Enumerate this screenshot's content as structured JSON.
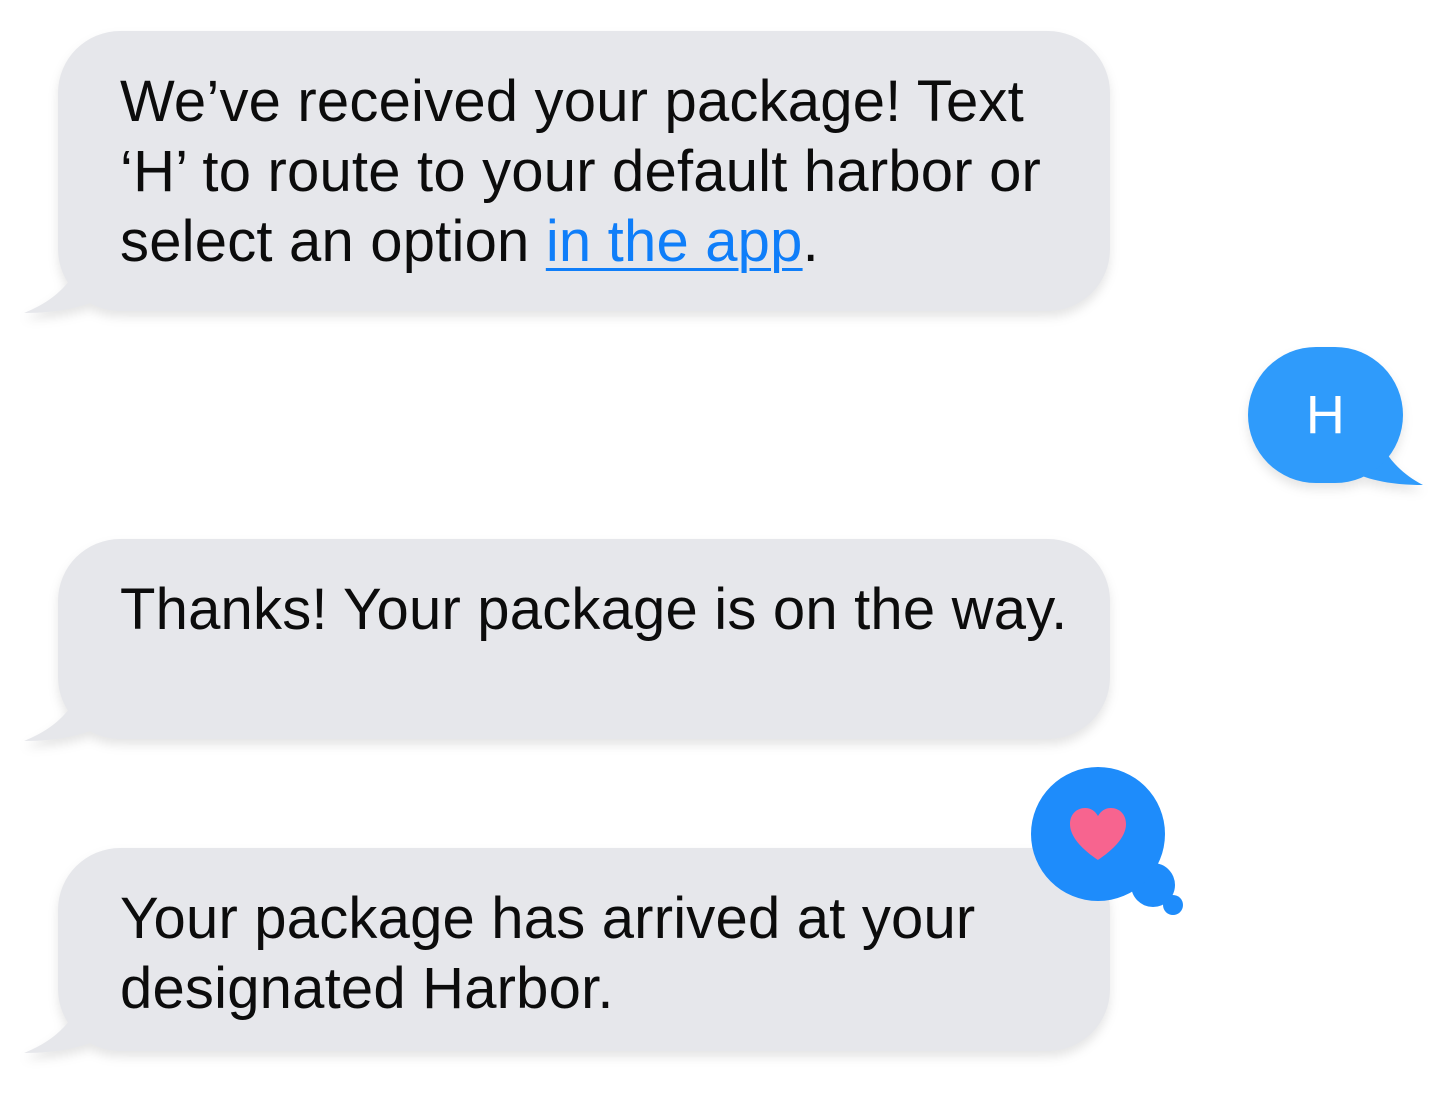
{
  "messages": [
    {
      "direction": "incoming",
      "text_before": "We’ve received your package! Text ‘H’ to route to your default harbor or select an option ",
      "link_text": "in the app",
      "text_after": "."
    },
    {
      "direction": "outgoing",
      "text": "H"
    },
    {
      "direction": "incoming",
      "text": "Thanks! Your package is on the way."
    },
    {
      "direction": "incoming",
      "text": "Your package has arrived at your designated Harbor.",
      "reaction": "heart-icon"
    }
  ],
  "colors": {
    "incoming_bubble": "#e6e7eb",
    "outgoing_bubble": "#2f9bfb",
    "link": "#0f7ef9",
    "reaction_bubble": "#1e8cfb",
    "heart": "#f7648f"
  }
}
